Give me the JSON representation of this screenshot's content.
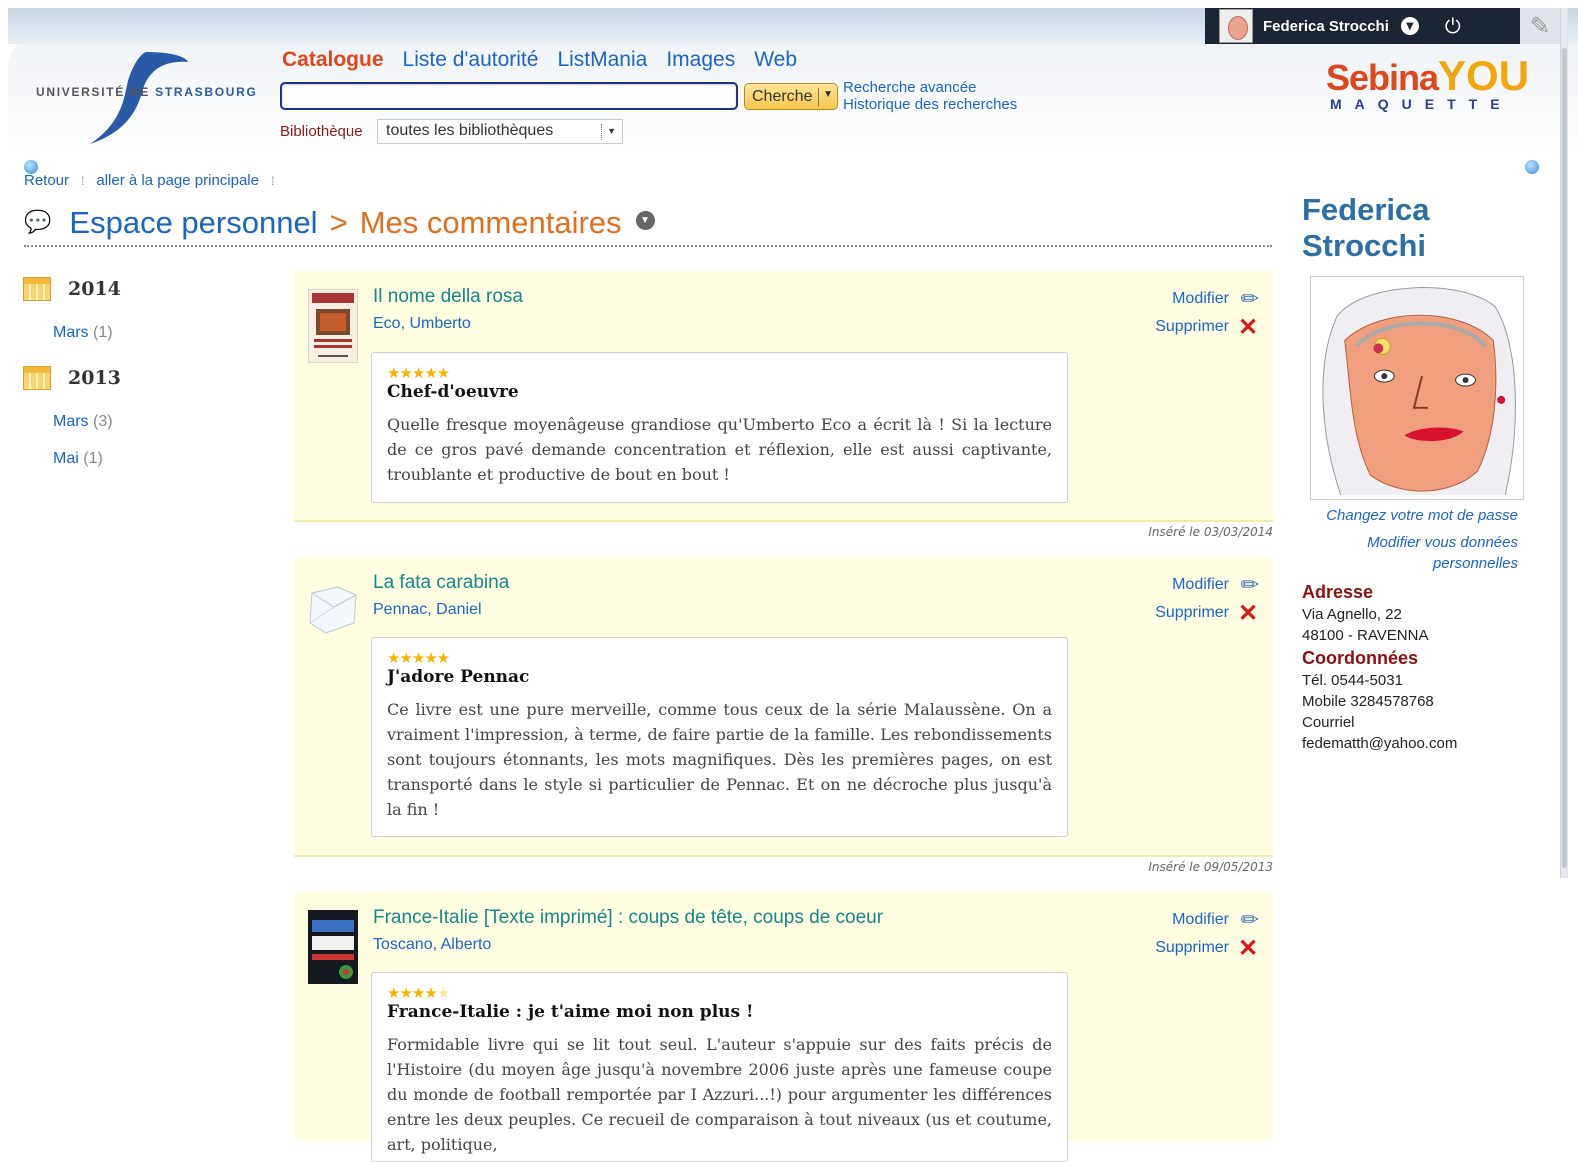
{
  "header": {
    "user_name": "Federica Strocchi",
    "university": {
      "prefix": "UNIVERSITÉ DE ",
      "highlight": "STRASBOURG"
    },
    "tabs": [
      "Catalogue",
      "Liste d'autorité",
      "ListMania",
      "Images",
      "Web"
    ],
    "active_tab": "Catalogue",
    "search": {
      "value": "",
      "button": "Cherche"
    },
    "advanced_search": "Recherche avancée",
    "search_history": "Historique des recherches",
    "library_label": "Bibliothèque",
    "library_value": "toutes les bibliothèques",
    "brand": {
      "sebina": "Sebina",
      "you": "YOU",
      "sub": "MAQUETTE"
    }
  },
  "breadcrumbs": {
    "back": "Retour",
    "home": "aller à la page principale"
  },
  "heading": {
    "space": "Espace personnel",
    "separator": ">",
    "section": "Mes commentaires"
  },
  "archive": [
    {
      "year": "2014",
      "months": [
        {
          "name": "Mars",
          "count": "(1)"
        }
      ]
    },
    {
      "year": "2013",
      "months": [
        {
          "name": "Mars",
          "count": "(3)"
        },
        {
          "name": "Mai",
          "count": "(1)"
        }
      ]
    }
  ],
  "action_labels": {
    "edit": "Modifier",
    "delete": "Supprimer"
  },
  "comments": [
    {
      "title": "Il nome della rosa",
      "author": "Eco, Umberto",
      "rating": 5,
      "stars": "★★★★★",
      "review_title": "Chef-d'oeuvre",
      "review_text": "Quelle fresque moyenâgeuse grandiose qu'Umberto Eco a écrit là ! Si la lecture de ce gros pavé demande concentration et réflexion, elle est aussi captivante, troublante et productive de bout en bout !",
      "inserted": "Inséré le 03/03/2014"
    },
    {
      "title": "La fata carabina",
      "author": "Pennac, Daniel",
      "rating": 5,
      "stars": "★★★★★",
      "review_title": "J'adore Pennac",
      "review_text": "Ce livre est une pure merveille, comme tous ceux de la série Malaussène. On a vraiment l'impression, à terme, de faire partie de la famille. Les rebondissements sont toujours étonnants, les mots magnifiques. Dès les premières pages, on est transporté dans le style si particulier de Pennac. Et on ne décroche plus jusqu'à la fin !",
      "inserted": "Inséré le 09/05/2013"
    },
    {
      "title": "France-Italie [Texte imprimé] : coups de tête, coups de coeur",
      "author": "Toscano, Alberto",
      "rating": 4,
      "stars": "★★★★",
      "stars_empty": "★",
      "review_title": "France-Italie : je t'aime moi non plus !",
      "review_text": "Formidable livre qui se lit tout seul. L'auteur s'appuie sur des faits précis de l'Histoire (du moyen âge jusqu'à novembre 2006 juste après une fameuse coupe du monde de football remportée par I Azzuri...!) pour argumenter les différences entre les deux peuples. Ce recueil de comparaison à tout niveaux (us et coutume, art, politique,"
    }
  ],
  "profile": {
    "first_name": "Federica",
    "last_name": "Strocchi",
    "change_password": "Changez votre mot de passe",
    "modify_data": "Modifier vous données personnelles",
    "address_label": "Adresse",
    "address_line1": "Via Agnello, 22",
    "address_line2": "48100 -  RAVENNA",
    "contacts_label": "Coordonnées",
    "phone": "Tél. 0544-5031",
    "mobile": "Mobile 3284578768",
    "email_label": "Courriel",
    "email": "fedematth@yahoo.com"
  },
  "colors": {
    "link_blue": "#1a66c2",
    "accent_orange": "#e0451c",
    "entry_bg": "#fffde1",
    "title_teal": "#16868c",
    "section_red": "#8b1010",
    "user_bar": "#1c2533"
  }
}
